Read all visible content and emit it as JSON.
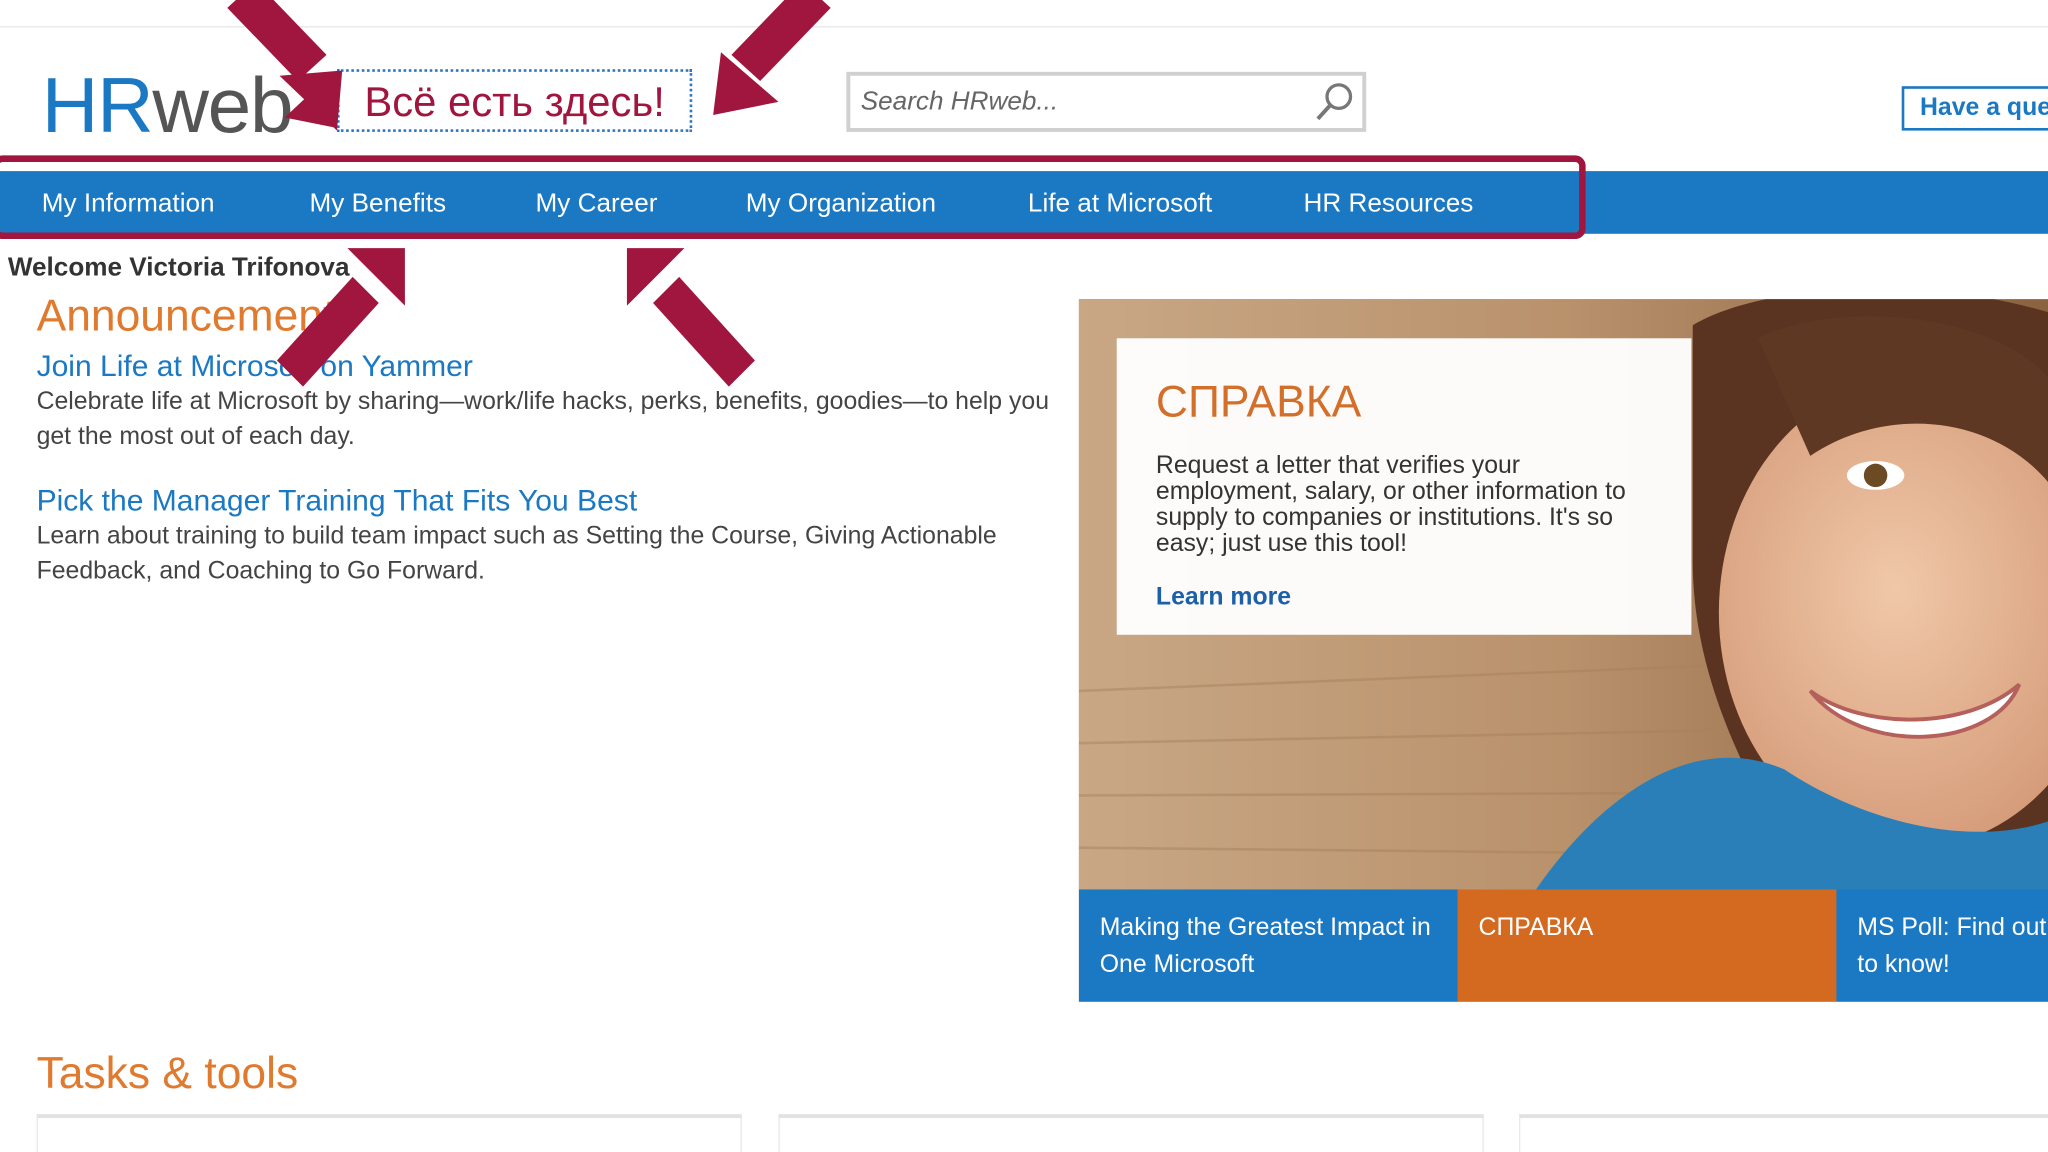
{
  "header": {
    "logo_hr": "HR",
    "logo_web": "web",
    "tagline": "Всё есть здесь!",
    "search_placeholder": "Search HRweb...",
    "question_button": "Have a que"
  },
  "nav": {
    "items": [
      {
        "label": "My Information"
      },
      {
        "label": "My Benefits"
      },
      {
        "label": "My Career"
      },
      {
        "label": "My Organization"
      },
      {
        "label": "Life at Microsoft"
      },
      {
        "label": "HR Resources"
      }
    ]
  },
  "main": {
    "welcome": "Welcome Victoria Trifonova",
    "announcements_title": "Announcements",
    "announcements": [
      {
        "title": "Join Life at Microsoft on Yammer",
        "text": "Celebrate life at Microsoft by sharing—work/life hacks, perks, benefits, goodies—to help you get the most out of each day."
      },
      {
        "title": "Pick the Manager Training That Fits You Best",
        "text": "Learn about training to build team impact such as Setting the Course, Giving Actionable Feedback, and Coaching to Go Forward."
      }
    ],
    "tasks_title": "Tasks & tools"
  },
  "hero": {
    "card_title": "СПРАВКА",
    "card_text": "Request a letter that verifies your employment, salary, or other information to supply to companies or institutions. It's so easy; just use this tool!",
    "card_link": "Learn more",
    "tiles": [
      {
        "label": "Making the Greatest Impact in One Microsoft"
      },
      {
        "label": "СПРАВКА"
      },
      {
        "label": "MS Poll: Find out to know!"
      }
    ]
  },
  "colors": {
    "brand_blue": "#1b78c2",
    "accent_orange": "#e07a2e",
    "annotation_red": "#a0163f"
  }
}
